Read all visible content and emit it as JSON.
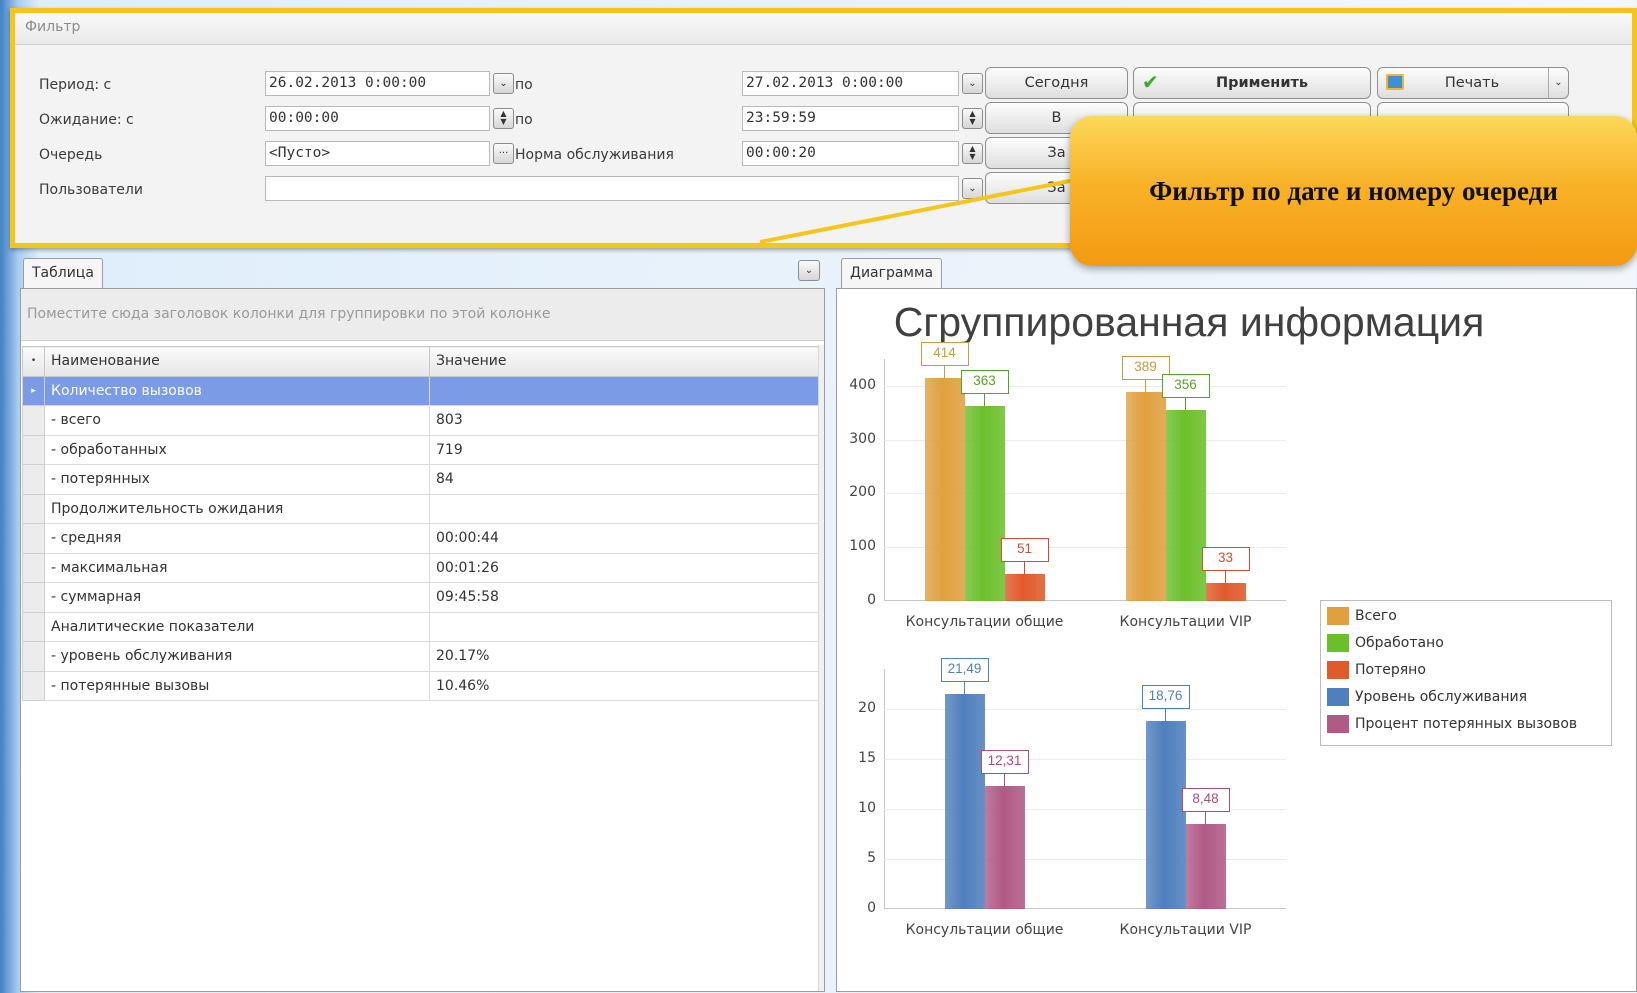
{
  "filter": {
    "title": "Фильтр",
    "period_label": "Период: с",
    "period_from": "26.02.2013 0:00:00",
    "period_to_label": "по",
    "period_to": "27.02.2013 0:00:00",
    "wait_label": "Ожидание: с",
    "wait_from": "00:00:00",
    "wait_to_label": "по",
    "wait_to": "23:59:59",
    "queue_label": "Очередь",
    "queue_value": "<Пусто>",
    "norm_label": "Норма обслуживания",
    "norm_value": "00:00:20",
    "users_label": "Пользователи",
    "users_value": "",
    "btn_today": "Сегодня",
    "btn_apply": "Применить",
    "btn_print": "Печать",
    "btn_row2": "В",
    "btn_row3": "За",
    "btn_row4": "За"
  },
  "callout": {
    "text": "Фильтр по дате и номеру очереди"
  },
  "table_panel": {
    "tab": "Таблица",
    "group_hint": "Поместите сюда заголовок колонки для группировки по этой колонке",
    "col_name": "Наименование",
    "col_value": "Значение",
    "rows": [
      {
        "name": "Количество вызовов",
        "value": ""
      },
      {
        "name": " - всего",
        "value": "803"
      },
      {
        "name": " - обработанных",
        "value": "719"
      },
      {
        "name": " - потерянных",
        "value": "84"
      },
      {
        "name": "Продолжительность ожидания",
        "value": ""
      },
      {
        "name": " - средняя",
        "value": "00:00:44"
      },
      {
        "name": " - максимальная",
        "value": "00:01:26"
      },
      {
        "name": " - суммарная",
        "value": "09:45:58"
      },
      {
        "name": "Аналитические показатели",
        "value": ""
      },
      {
        "name": " - уровень обслуживания",
        "value": "20.17%"
      },
      {
        "name": " - потерянные вызовы",
        "value": "10.46%"
      }
    ]
  },
  "chart_panel": {
    "tab": "Диаграмма"
  },
  "chart_data": [
    {
      "type": "bar",
      "title": "Сгруппированная информация",
      "categories": [
        "Консультации общие",
        "Консультации VIP"
      ],
      "series": [
        {
          "name": "Всего",
          "values": [
            414,
            389
          ],
          "color": "#e0a040",
          "label_color": "#c79a45"
        },
        {
          "name": "Обработано",
          "values": [
            363,
            356
          ],
          "color": "#6cbf2c",
          "label_color": "#5aa028"
        },
        {
          "name": "Потеряно",
          "values": [
            51,
            33
          ],
          "color": "#e05a2a",
          "label_color": "#c84e35"
        }
      ],
      "ylim": [
        0,
        450
      ],
      "yticks": [
        0,
        100,
        200,
        300,
        400
      ],
      "grid": true
    },
    {
      "type": "bar",
      "categories": [
        "Консультации общие",
        "Консультации VIP"
      ],
      "series": [
        {
          "name": "Уровень обслуживания",
          "values": [
            21.49,
            18.76
          ],
          "labels": [
            "21,49",
            "18,76"
          ],
          "color": "#4f7fbd",
          "label_color": "#4f7fbd"
        },
        {
          "name": "Процент потерянных вызовов",
          "values": [
            12.31,
            8.48
          ],
          "labels": [
            "12,31",
            "8,48"
          ],
          "color": "#b05a86",
          "label_color": "#a84e7c"
        }
      ],
      "ylim": [
        0,
        24
      ],
      "yticks": [
        0,
        5,
        10,
        15,
        20
      ],
      "grid": true
    }
  ],
  "legend": {
    "placement": "right",
    "items": [
      {
        "name": "Всего",
        "color": "#e0a040"
      },
      {
        "name": "Обработано",
        "color": "#6cbf2c"
      },
      {
        "name": "Потеряно",
        "color": "#e05a2a"
      },
      {
        "name": "Уровень обслуживания",
        "color": "#4f7fbd"
      },
      {
        "name": "Процент потерянных вызовов",
        "color": "#b05a86"
      }
    ]
  },
  "colors": {
    "highlight": "#f5c518",
    "callout": "#f7a21b",
    "selection": "#7b9be6"
  }
}
